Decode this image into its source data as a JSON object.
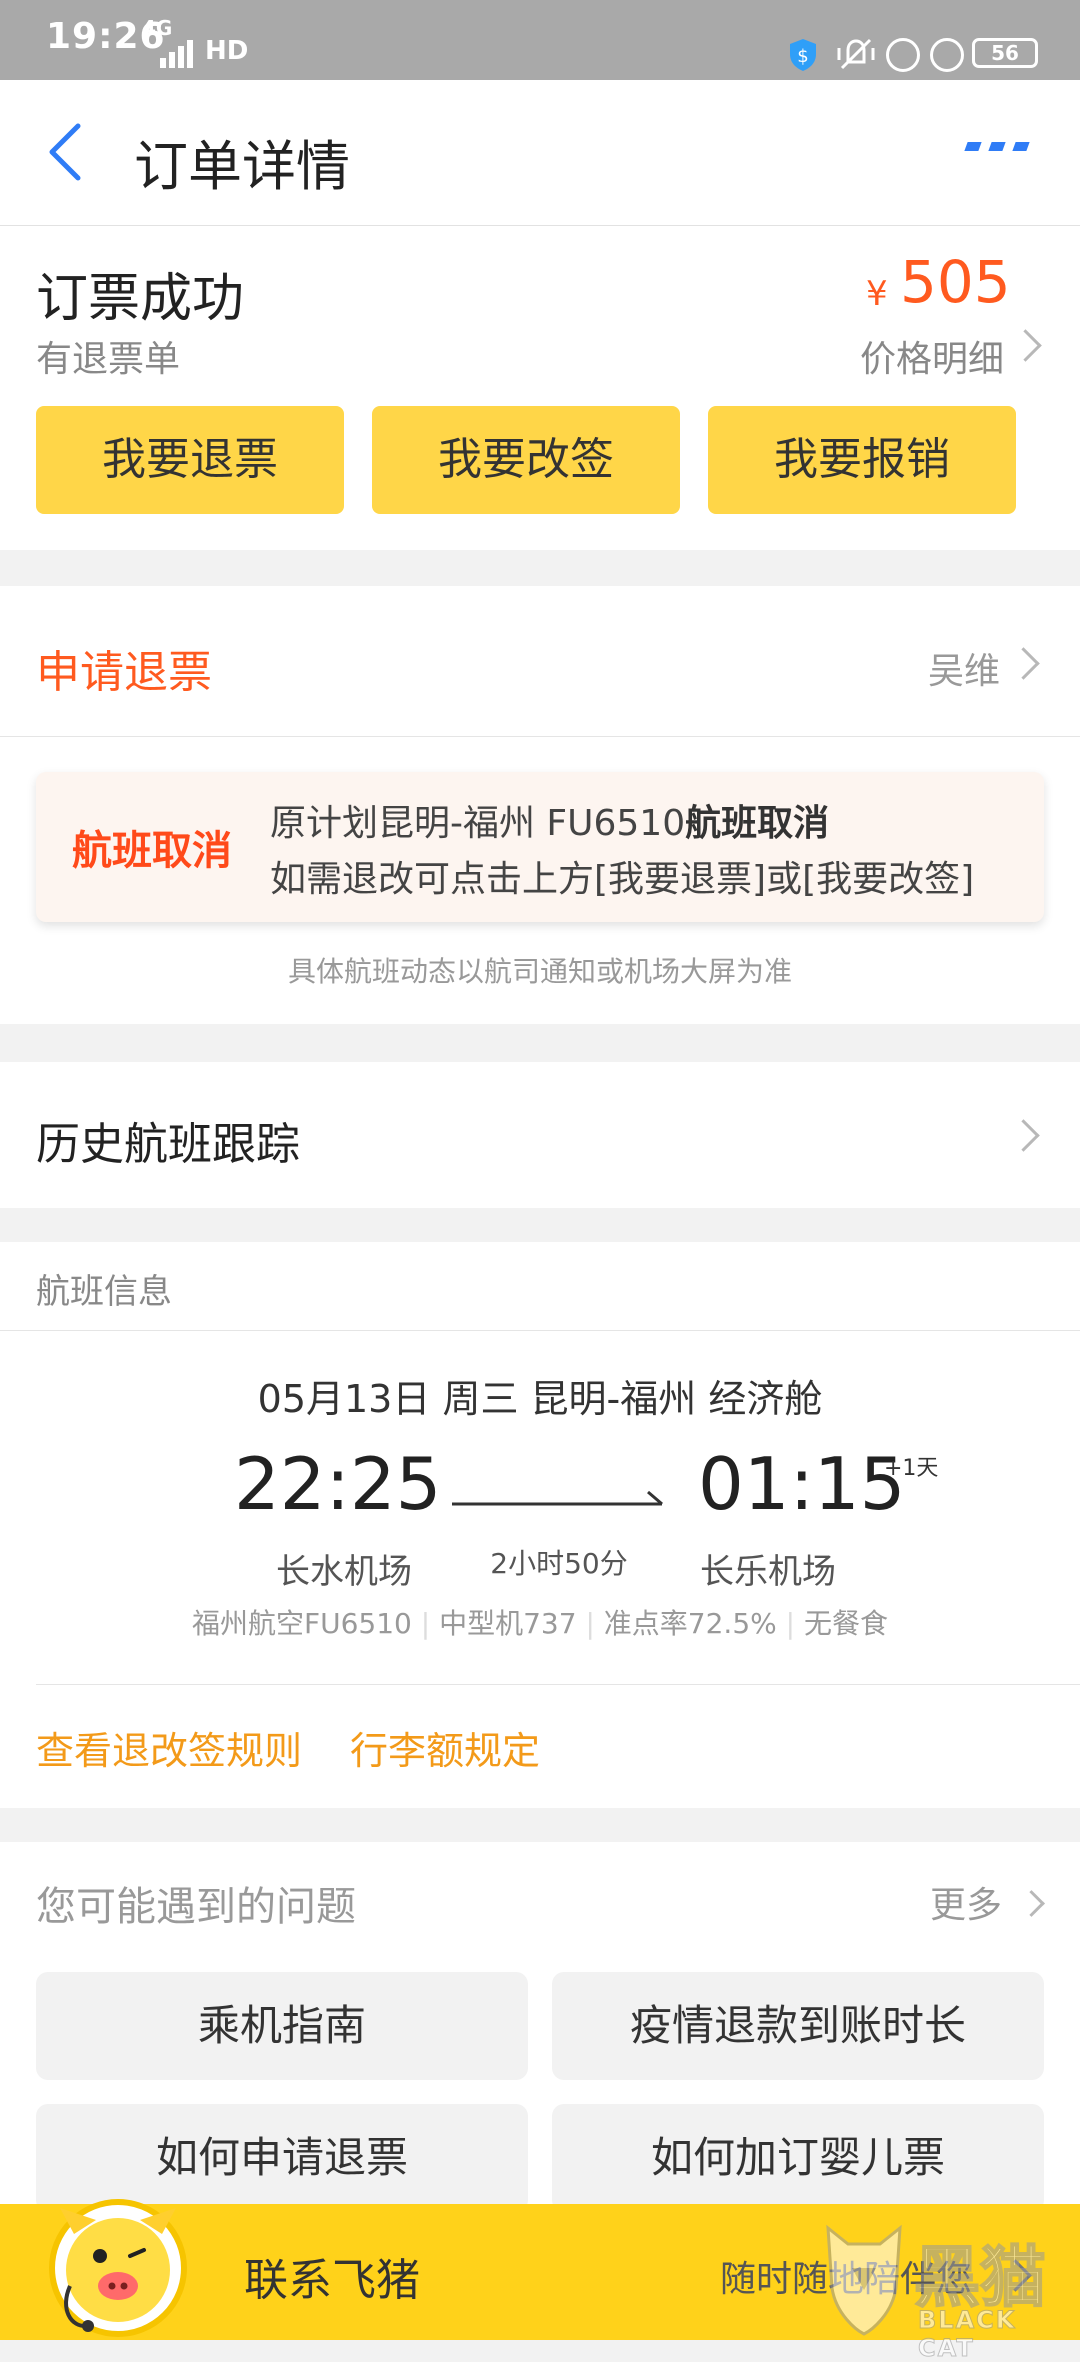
{
  "status_bar": {
    "time": "19:26",
    "network": "4G",
    "hd": "HD",
    "battery": "56"
  },
  "header": {
    "title": "订单详情",
    "menu_dots": "···"
  },
  "order": {
    "status": "订票成功",
    "sub_status": "有退票单",
    "currency": "¥",
    "price": "505",
    "price_detail": "价格明细",
    "buttons": [
      "我要退票",
      "我要改签",
      "我要报销"
    ]
  },
  "refund": {
    "label": "申请退票",
    "passenger": "吴维"
  },
  "notice": {
    "badge": "航班取消",
    "line1_prefix": "原计划昆明-福州 FU6510",
    "line1_bold": "航班取消",
    "line2": "如需退改可点击上方[我要退票]或[我要改签]",
    "footnote": "具体航班动态以航司通知或机场大屏为准"
  },
  "history": {
    "label": "历史航班跟踪"
  },
  "flight": {
    "section_title": "航班信息",
    "date_line": "05月13日 周三 昆明-福州 经济舱",
    "dep_time": "22:25",
    "arr_time": "01:15",
    "next_day": "+1天",
    "duration": "2小时50分",
    "dep_airport": "长水机场",
    "arr_airport": "长乐机场",
    "info": [
      "福州航空FU6510",
      "中型机737",
      "准点率72.5%",
      "无餐食"
    ],
    "links": [
      "查看退改签规则",
      "行李额规定"
    ]
  },
  "faq": {
    "title": "您可能遇到的问题",
    "more": "更多",
    "items": [
      "乘机指南",
      "疫情退款到账时长",
      "如何申请退票",
      "如何加订婴儿票"
    ]
  },
  "bottom_bar": {
    "label": "联系飞猪",
    "right_text": "随时随地陪伴您"
  },
  "watermark": {
    "cn": "黑猫",
    "en": "BLACK CAT"
  },
  "colors": {
    "accent_orange": "#ff5a1f",
    "brand_yellow": "#ffd648",
    "link_orange": "#f39a19",
    "blue": "#2f7cf6"
  }
}
